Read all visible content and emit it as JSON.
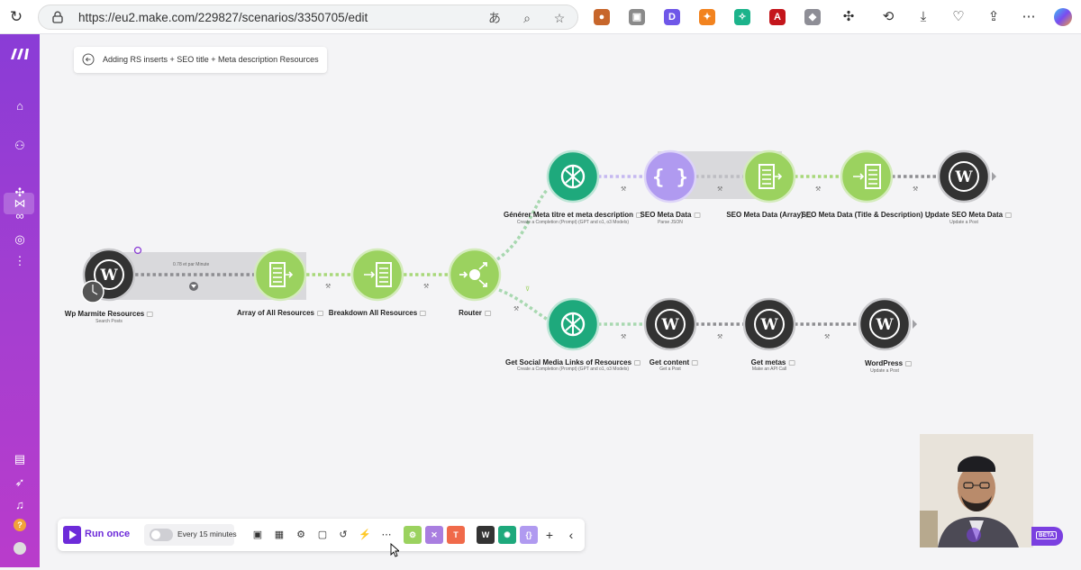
{
  "browser": {
    "url": "https://eu2.make.com/229827/scenarios/3350705/edit"
  },
  "scenario": {
    "title": "Adding RS inserts + SEO title + Meta description Resources"
  },
  "nodes": [
    {
      "id": "wp-marmite",
      "label": "Wp Marmite Resources",
      "sub": "Search Posts",
      "icon": "wordpress-icon",
      "color": "#333333"
    },
    {
      "id": "array-all",
      "label": "Array of All Resources",
      "sub": "",
      "icon": "array-aggregator-icon",
      "color": "#9bd25f"
    },
    {
      "id": "breakdown-all",
      "label": "Breakdown All Resources",
      "sub": "",
      "icon": "iterator-icon",
      "color": "#9bd25f"
    },
    {
      "id": "router",
      "label": "Router",
      "sub": "",
      "icon": "router-icon",
      "color": "#9bd25f"
    },
    {
      "id": "gen-meta",
      "label": "Générer Meta titre et meta description",
      "sub": "Create a Completion (Prompt) (GPT and o1, o3 Models)",
      "icon": "openai-icon",
      "color": "#1ea97c"
    },
    {
      "id": "seo-meta-data",
      "label": "SEO Meta Data",
      "sub": "Parse JSON",
      "icon": "json-icon",
      "color": "#b09af0"
    },
    {
      "id": "seo-meta-array",
      "label": "SEO Meta Data (Array)",
      "sub": "",
      "icon": "array-aggregator-icon",
      "color": "#9bd25f"
    },
    {
      "id": "seo-meta-title",
      "label": "SEO Meta Data (Title & Description)",
      "sub": "",
      "icon": "iterator-icon",
      "color": "#9bd25f"
    },
    {
      "id": "update-seo",
      "label": "Update SEO Meta Data",
      "sub": "Update a Post",
      "icon": "wordpress-icon",
      "color": "#333333"
    },
    {
      "id": "get-social",
      "label": "Get  Social Media Links of Resources",
      "sub": "Create a Completion (Prompt) (GPT and o1, o3 Models)",
      "icon": "openai-icon",
      "color": "#1ea97c"
    },
    {
      "id": "get-content",
      "label": "Get content",
      "sub": "Get a Post",
      "icon": "wordpress-icon",
      "color": "#333333"
    },
    {
      "id": "get-metas",
      "label": "Get metas",
      "sub": "Make an API Call",
      "icon": "wordpress-icon",
      "color": "#333333"
    },
    {
      "id": "wordpress",
      "label": "WordPress",
      "sub": "Update a Post",
      "icon": "wordpress-icon",
      "color": "#333333"
    }
  ],
  "trigger_note": "0.78 et par Minute",
  "toolbar": {
    "run_label": "Run once",
    "schedule_label": "Every 15 minutes",
    "beta_label": "BETA"
  },
  "colors": {
    "sidebar": "#8a3cd6",
    "run": "#6d2bd9",
    "tools_green": "#9bd25f",
    "flow_purple": "#a97ee0",
    "tools_orange": "#f06a4a"
  }
}
